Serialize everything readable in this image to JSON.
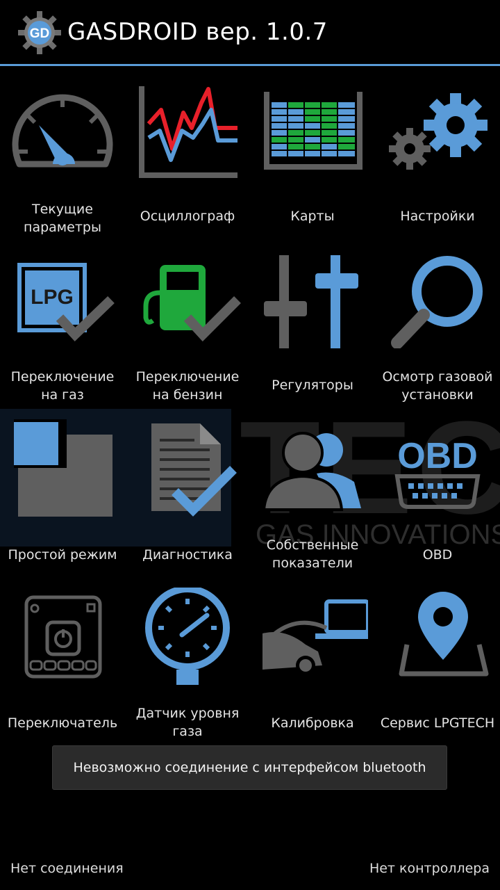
{
  "header": {
    "title": "GASDROID вер. 1.0.7",
    "logo_text": "GD"
  },
  "watermark": {
    "brand": "TECH",
    "tagline": "GAS INNOVATIONS"
  },
  "tiles": [
    {
      "label": "Текущие\nпараметры",
      "icon": "speedometer-icon"
    },
    {
      "label": "Осциллограф",
      "icon": "oscilloscope-icon"
    },
    {
      "label": "Карты",
      "icon": "map-grid-icon"
    },
    {
      "label": "Настройки",
      "icon": "gears-icon"
    },
    {
      "label": "Переключение\nна газ",
      "icon": "lpg-check-icon",
      "icon_text": "LPG"
    },
    {
      "label": "Переключение\nна бензин",
      "icon": "fuel-pump-check-icon"
    },
    {
      "label": "Регуляторы",
      "icon": "sliders-icon"
    },
    {
      "label": "Осмотр газовой\nустановки",
      "icon": "magnifier-icon"
    },
    {
      "label": "Простой режим",
      "icon": "simple-mode-icon"
    },
    {
      "label": "Диагностика",
      "icon": "document-check-icon"
    },
    {
      "label": "Собственные\nпоказатели",
      "icon": "users-icon"
    },
    {
      "label": "OBD",
      "icon": "obd-connector-icon",
      "icon_text": "OBD"
    },
    {
      "label": "Переключатель",
      "icon": "switch-panel-icon"
    },
    {
      "label": "Датчик уровня\nгаза",
      "icon": "level-gauge-icon"
    },
    {
      "label": "Калибровка",
      "icon": "car-laptop-icon"
    },
    {
      "label": "Сервис LPGTECH",
      "icon": "location-pin-icon"
    }
  ],
  "toast": {
    "message": "Невозможно соединение с интерфейсом bluetooth"
  },
  "status": {
    "connection": "Нет соединения",
    "controller": "Нет контроллера"
  },
  "colors": {
    "accent": "#5a9bd8",
    "icon_gray": "#5f5f5f",
    "alert_red": "#e8202a",
    "green": "#1fa83c"
  }
}
